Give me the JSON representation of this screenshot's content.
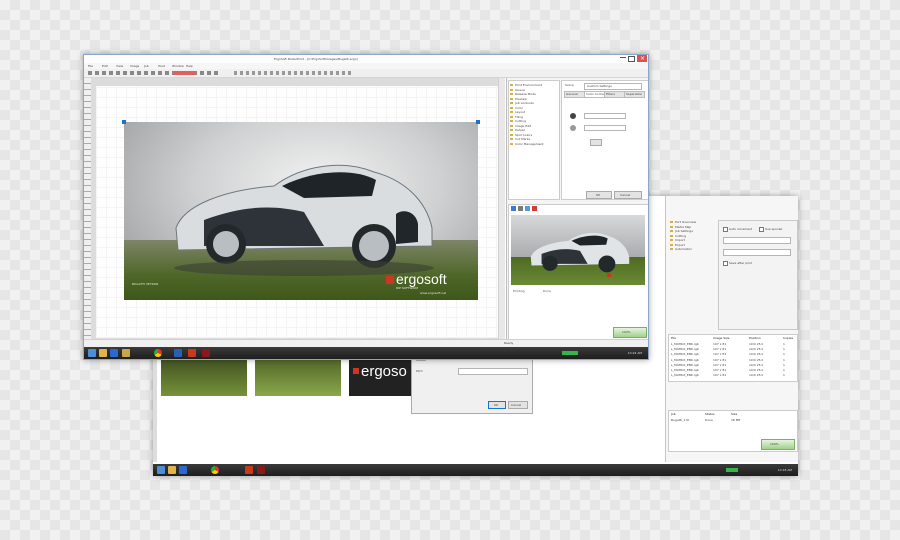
{
  "front_window": {
    "title": "ErgoSoft PosterPrint - [C:\\ErgoSoft\\Images\\Bugatti.ergo]",
    "menu": [
      "File",
      "Edit",
      "View",
      "Image",
      "Job",
      "Tools",
      "Window",
      "Help"
    ],
    "status_text": "Ready",
    "image": {
      "brand": "ergosoft",
      "tagline": "RIP SOFTWARE",
      "url": "www.ergosoft.net",
      "left_caption": "BUGATTI VEYRON"
    },
    "right_panel": {
      "tree_items": [
        "Print Environment",
        "Queue",
        "Release Mode",
        "Preview",
        "Job Lockouts",
        "Color",
        "Layout",
        "Tiling",
        "Cutting",
        "Image Edit",
        "Output",
        "Spot Colors",
        "Cut Marks",
        "Color Management"
      ],
      "tabs": [
        "General",
        "Color Correct",
        "Filters",
        "Separation"
      ],
      "dropdown_value": "Custom Settings",
      "ok_label": "OK",
      "cancel_label": "Cancel"
    },
    "preview_panel": {
      "toolbar_icons": [
        "zoom-icon",
        "hand-icon",
        "fit-icon",
        "color-icon"
      ],
      "status_label": "Printing",
      "status_value": "Done",
      "percent": "100%"
    },
    "taskbar_clock": "10:24 AM"
  },
  "back_window": {
    "thumb_brand": "ergoso",
    "dialog": {
      "title": "Output",
      "field_label": "Path",
      "ok_label": "OK",
      "cancel_label": "Cancel"
    },
    "side_panel": {
      "tree_items": [
        "Port Overview",
        "Media Map",
        "Job Settings",
        "Cutting",
        "Import",
        "Export",
        "Automation"
      ],
      "checkbox_labels": [
        "Auto increment",
        "Use spooler",
        "Save after print"
      ],
      "table_headers": [
        "File",
        "Image Size",
        "Position",
        "Copies"
      ],
      "table_rows": [
        [
          "L_MATRIX_EBK.rgb",
          "107 x 81",
          "10/0 25.0",
          "1"
        ],
        [
          "L_MATRIX_EBK.rgb",
          "107 x 81",
          "10/0 25.0",
          "1"
        ],
        [
          "L_MATRIX_EBK.rgb",
          "107 x 81",
          "10/0 25.0",
          "1"
        ],
        [
          "L_MATRIX_EBK.rgb",
          "107 x 81",
          "10/0 25.0",
          "1"
        ],
        [
          "L_MATRIX_EBK.rgb",
          "107 x 81",
          "10/0 25.0",
          "1"
        ],
        [
          "L_MATRIX_EBK.rgb",
          "107 x 81",
          "10/0 25.0",
          "1"
        ],
        [
          "L_MATRIX_EBK.rgb",
          "107 x 81",
          "10/0 25.0",
          "1"
        ]
      ],
      "bottom_headers": [
        "Job",
        "Status",
        "Size"
      ],
      "bottom_row": [
        "Bugatti_1.tif",
        "Done",
        "18 MB"
      ],
      "percent": "100%"
    },
    "taskbar_clock": "10:18 AM"
  },
  "colors": {
    "accent": "#1b74c9",
    "taskbar": "#2a2a2a",
    "brand_green": "#5a7a2a",
    "ergosoft_red": "#d0351f"
  }
}
